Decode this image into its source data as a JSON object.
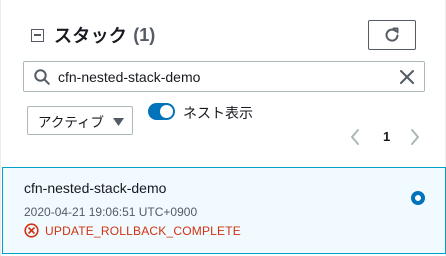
{
  "header": {
    "title": "スタック",
    "count": "(1)"
  },
  "search": {
    "value": "cfn-nested-stack-demo"
  },
  "filter": {
    "selected": "アクティブ"
  },
  "nested_toggle": {
    "label": "ネスト表示",
    "on": true
  },
  "pagination": {
    "current_page": "1"
  },
  "stacks": [
    {
      "name": "cfn-nested-stack-demo",
      "created": "2020-04-21 19:06:51 UTC+0900",
      "status": "UPDATE_ROLLBACK_COMPLETE",
      "selected": true
    }
  ],
  "colors": {
    "accent": "#0073bb",
    "error": "#d13212",
    "selected_bg": "#f1faff",
    "selected_border": "#00a1c9"
  },
  "icons": [
    "collapse-icon",
    "refresh-icon",
    "search-icon",
    "clear-icon",
    "caret-down-icon",
    "chevron-left-icon",
    "chevron-right-icon",
    "error-icon"
  ]
}
